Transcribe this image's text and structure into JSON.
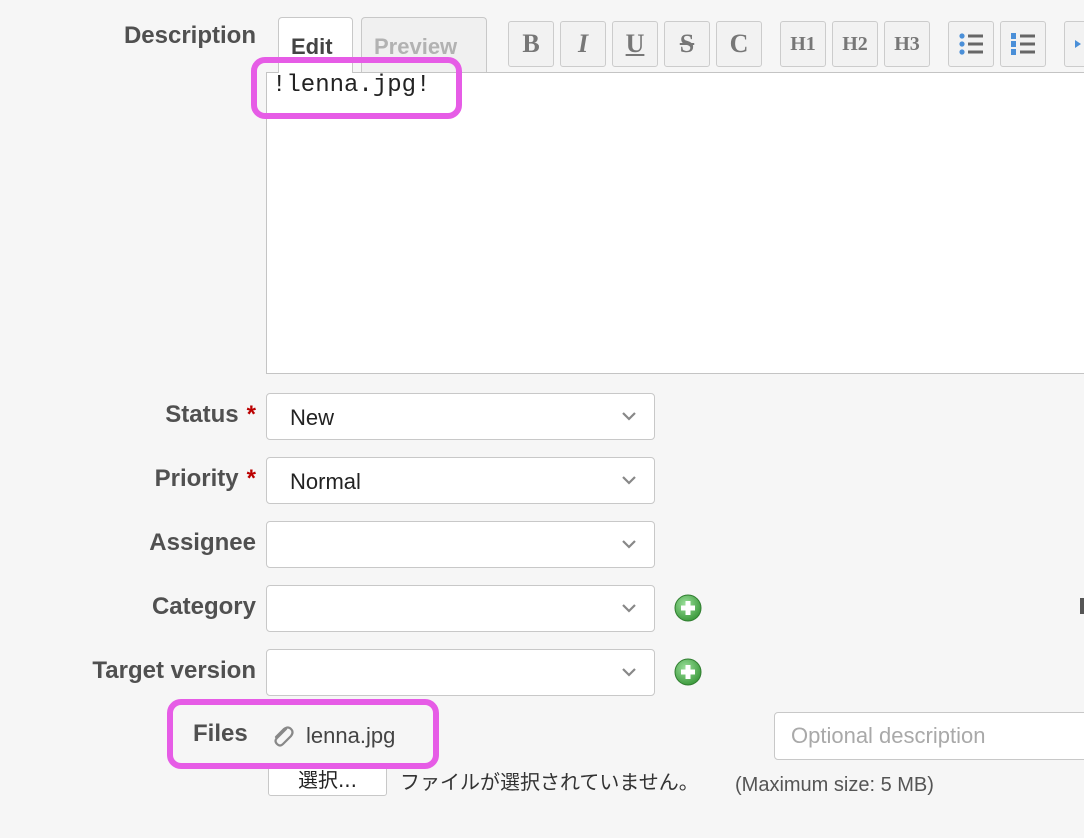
{
  "description": {
    "label": "Description",
    "tabs": [
      {
        "label": "Edit",
        "active": true
      },
      {
        "label": "Preview",
        "active": false
      }
    ],
    "toolbar": [
      {
        "label": "B",
        "icon": "bold-icon"
      },
      {
        "label": "I",
        "icon": "italic-icon"
      },
      {
        "label": "U",
        "icon": "underline-icon"
      },
      {
        "label": "S",
        "icon": "strikethrough-icon"
      },
      {
        "label": "C",
        "icon": "code-icon"
      },
      {
        "label": "H1",
        "icon": "heading1-icon"
      },
      {
        "label": "H2",
        "icon": "heading2-icon"
      },
      {
        "label": "H3",
        "icon": "heading3-icon"
      },
      {
        "label": "",
        "icon": "bullet-list-icon"
      },
      {
        "label": "",
        "icon": "numbered-list-icon"
      },
      {
        "label": "",
        "icon": "indent-icon"
      }
    ],
    "text": "!lenna.jpg!"
  },
  "fields": {
    "status": {
      "label": "Status",
      "required": "*",
      "value": "New"
    },
    "priority": {
      "label": "Priority",
      "required": "*",
      "value": "Normal"
    },
    "assignee": {
      "label": "Assignee",
      "value": ""
    },
    "category": {
      "label": "Category",
      "value": ""
    },
    "target_version": {
      "label": "Target version",
      "value": ""
    }
  },
  "files": {
    "label": "Files",
    "filename": "lenna.jpg",
    "description_placeholder": "Optional description",
    "choose_button": "選択...",
    "no_file_text": "ファイルが選択されていません。",
    "max_size": "(Maximum size: 5 MB)"
  },
  "colors": {
    "highlight": "#e65ce6",
    "required": "#bb0000",
    "add_icon": "#5cb85c"
  }
}
